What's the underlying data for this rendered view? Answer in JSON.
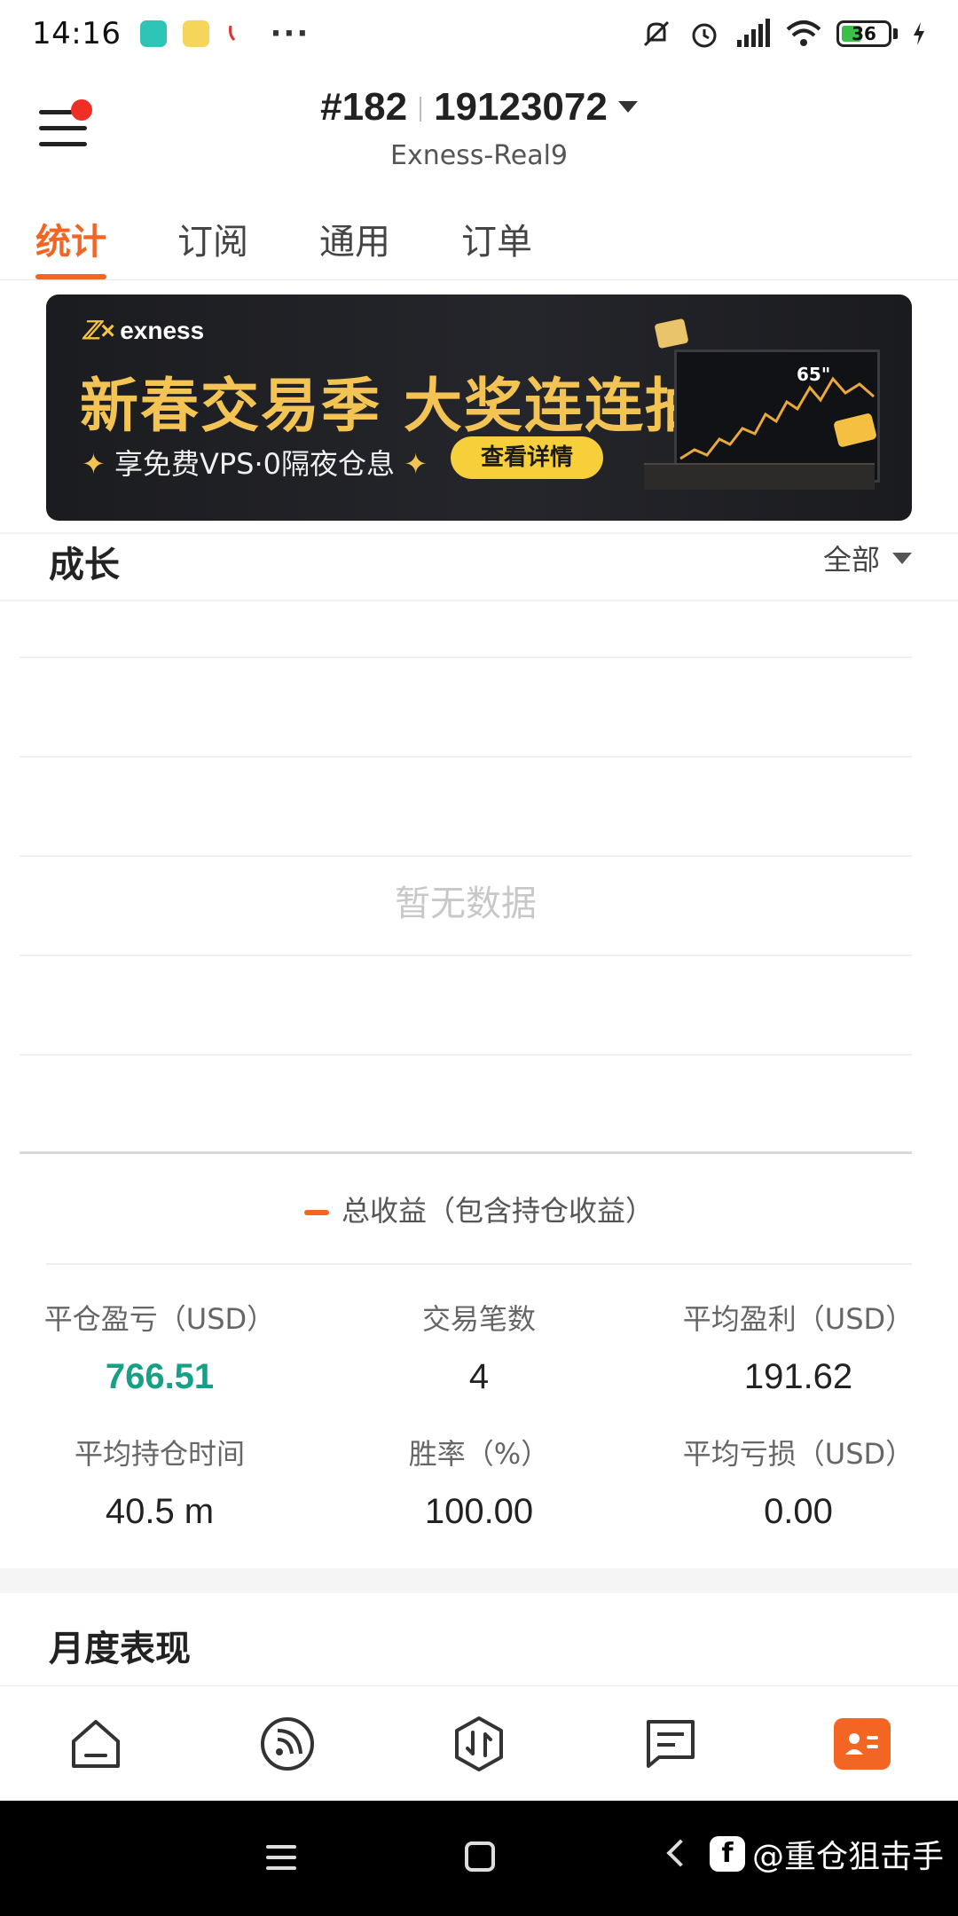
{
  "status_bar": {
    "time": "14:16",
    "battery": "36"
  },
  "header": {
    "account_number": "#182",
    "account_id": "19123072",
    "server": "Exness-Real9"
  },
  "tabs": [
    {
      "label": "统计",
      "active": true
    },
    {
      "label": "订阅",
      "active": false
    },
    {
      "label": "通用",
      "active": false
    },
    {
      "label": "订单",
      "active": false
    }
  ],
  "banner": {
    "brand": "exness",
    "title": "新春交易季 大奖连连抽",
    "subtitle": "享免费VPS·0隔夜仓息",
    "button": "查看详情",
    "tv_text": "65\""
  },
  "growth": {
    "title": "成长",
    "filter": "全部",
    "empty_text": "暂无数据",
    "legend": "总收益（包含持仓收益）"
  },
  "stats": [
    {
      "label": "平仓盈亏（USD）",
      "value": "766.51",
      "color": "#16a085"
    },
    {
      "label": "交易笔数",
      "value": "4"
    },
    {
      "label": "平均盈利（USD）",
      "value": "191.62"
    },
    {
      "label": "平均持仓时间",
      "value": "40.5 m"
    },
    {
      "label": "胜率（%）",
      "value": "100.00"
    },
    {
      "label": "平均亏损（USD）",
      "value": "0.00"
    }
  ],
  "monthly": {
    "title": "月度表现"
  },
  "bottom_nav": [
    {
      "icon": "home-icon"
    },
    {
      "icon": "feed-icon"
    },
    {
      "icon": "trade-icon"
    },
    {
      "icon": "news-icon"
    },
    {
      "icon": "account-card-icon",
      "active": true
    }
  ],
  "watermark": "@重仓狙击手",
  "colors": {
    "accent": "#f26522",
    "profit_green": "#16a085",
    "banner_gold": "#f3c453"
  }
}
